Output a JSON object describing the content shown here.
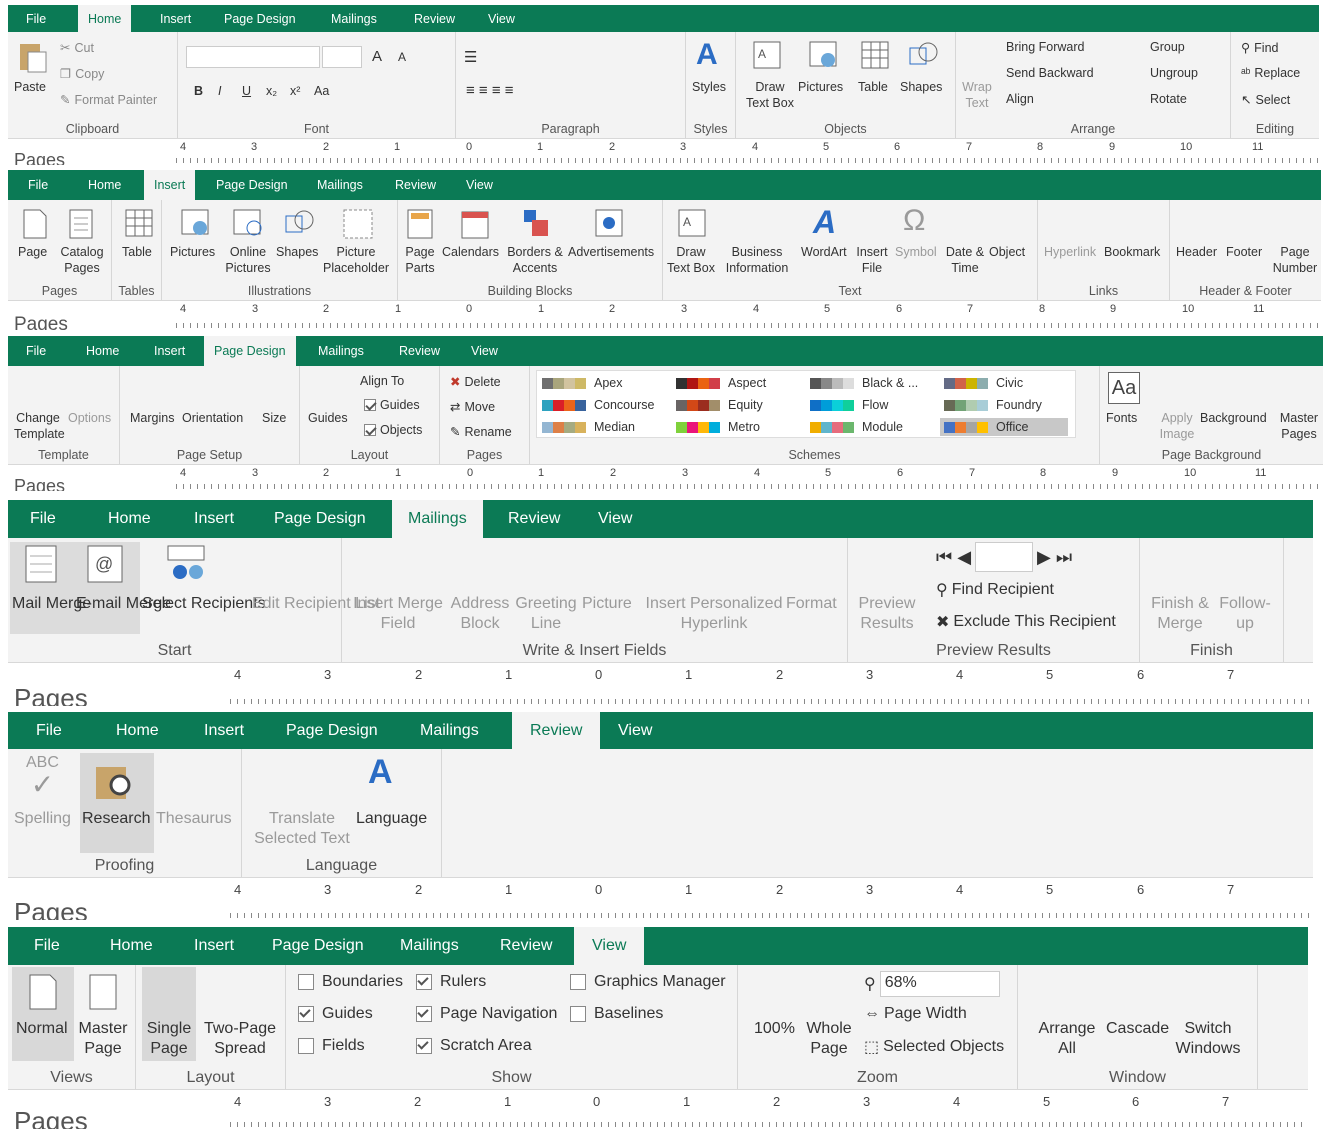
{
  "tabs": [
    "File",
    "Home",
    "Insert",
    "Page Design",
    "Mailings",
    "Review",
    "View"
  ],
  "home": {
    "clipboard": {
      "paste": "Paste",
      "cut": "Cut",
      "copy": "Copy",
      "format_painter": "Format Painter",
      "label": "Clipboard"
    },
    "font": {
      "bold": "B",
      "italic": "I",
      "underline": "U",
      "sub": "x₂",
      "sup": "x²",
      "grow": "A",
      "shrink": "A",
      "aa": "Aa",
      "label": "Font"
    },
    "paragraph": {
      "label": "Paragraph"
    },
    "styles": {
      "styles": "Styles",
      "label": "Styles"
    },
    "objects": {
      "draw_text_box": "Draw Text Box",
      "pictures": "Pictures",
      "table": "Table",
      "shapes": "Shapes",
      "label": "Objects"
    },
    "arrange": {
      "wrap_text": "Wrap Text",
      "bring_forward": "Bring Forward",
      "send_backward": "Send Backward",
      "align": "Align",
      "group": "Group",
      "ungroup": "Ungroup",
      "rotate": "Rotate",
      "label": "Arrange"
    },
    "editing": {
      "find": "Find",
      "replace": "Replace",
      "select": "Select",
      "label": "Editing"
    }
  },
  "insert": {
    "pages": {
      "page": "Page",
      "catalog_pages": "Catalog Pages",
      "label": "Pages"
    },
    "tables": {
      "table": "Table",
      "label": "Tables"
    },
    "illustrations": {
      "pictures": "Pictures",
      "online_pictures": "Online Pictures",
      "shapes": "Shapes",
      "picture_placeholder": "Picture Placeholder",
      "label": "Illustrations"
    },
    "building_blocks": {
      "page_parts": "Page Parts",
      "calendars": "Calendars",
      "borders_accents": "Borders & Accents",
      "advertisements": "Advertisements",
      "label": "Building Blocks"
    },
    "text": {
      "draw_text_box": "Draw Text Box",
      "business_information": "Business Information",
      "wordart": "WordArt",
      "insert_file": "Insert File",
      "symbol": "Symbol",
      "date_time": "Date & Time",
      "object": "Object",
      "label": "Text"
    },
    "links": {
      "hyperlink": "Hyperlink",
      "bookmark": "Bookmark",
      "label": "Links"
    },
    "header_footer": {
      "header": "Header",
      "footer": "Footer",
      "page_number": "Page Number",
      "label": "Header & Footer"
    }
  },
  "design": {
    "template": {
      "change_template": "Change Template",
      "options": "Options",
      "label": "Template"
    },
    "page_setup": {
      "margins": "Margins",
      "orientation": "Orientation",
      "size": "Size",
      "label": "Page Setup"
    },
    "layout": {
      "guides": "Guides",
      "align_to": "Align To",
      "guides_check": "Guides",
      "objects_check": "Objects",
      "label": "Layout"
    },
    "pages": {
      "delete": "Delete",
      "move": "Move",
      "rename": "Rename",
      "label": "Pages"
    },
    "schemes": {
      "items": [
        "Apex",
        "Aspect",
        "Black & ...",
        "Civic",
        "Concourse",
        "Equity",
        "Flow",
        "Foundry",
        "Median",
        "Metro",
        "Module",
        "Office"
      ],
      "label": "Schemes"
    },
    "background": {
      "fonts": "Fonts",
      "apply_image": "Apply Image",
      "background": "Background",
      "master_pages": "Master Pages",
      "label": "Page Background"
    }
  },
  "mailings": {
    "start": {
      "mail_merge": "Mail Merge",
      "email_merge": "E-mail Merge",
      "select_recipients": "Select Recipients",
      "edit_recipient_list": "Edit Recipient List",
      "label": "Start"
    },
    "write": {
      "insert_merge_field": "Insert Merge Field",
      "address_block": "Address Block",
      "greeting_line": "Greeting Line",
      "picture": "Picture",
      "insert_personalized_hyperlink": "Insert Personalized Hyperlink",
      "format": "Format",
      "label": "Write & Insert Fields"
    },
    "preview": {
      "preview_results": "Preview Results",
      "find_recipient": "Find Recipient",
      "exclude": "Exclude This Recipient",
      "label": "Preview Results"
    },
    "finish": {
      "finish_merge": "Finish & Merge",
      "follow_up": "Follow-up",
      "label": "Finish"
    }
  },
  "review": {
    "proofing": {
      "abc": "ABC",
      "spelling": "Spelling",
      "research": "Research",
      "thesaurus": "Thesaurus",
      "label": "Proofing"
    },
    "language": {
      "translate": "Translate Selected Text",
      "language": "Language",
      "label": "Language"
    }
  },
  "view": {
    "views": {
      "normal": "Normal",
      "master_page": "Master Page",
      "label": "Views"
    },
    "layout": {
      "single_page": "Single Page",
      "two_page_spread": "Two-Page Spread",
      "label": "Layout"
    },
    "show": {
      "boundaries": "Boundaries",
      "guides": "Guides",
      "fields": "Fields",
      "rulers": "Rulers",
      "page_navigation": "Page Navigation",
      "scratch_area": "Scratch Area",
      "graphics_manager": "Graphics Manager",
      "baselines": "Baselines",
      "label": "Show"
    },
    "zoom": {
      "pct100": "100%",
      "whole_page": "Whole Page",
      "zoom_value": "68%",
      "page_width": "Page Width",
      "selected_objects": "Selected Objects",
      "label": "Zoom"
    },
    "window": {
      "arrange_all": "Arrange All",
      "cascade": "Cascade",
      "switch_windows": "Switch Windows",
      "label": "Window"
    }
  },
  "pages_pane": "Pages",
  "ruler_ticks_small": [
    "4",
    "3",
    "2",
    "1",
    "0",
    "1",
    "2",
    "3",
    "4",
    "5",
    "6",
    "7",
    "8",
    "9",
    "10",
    "11"
  ],
  "ruler_ticks_large": [
    "4",
    "3",
    "2",
    "1",
    "0",
    "1",
    "2",
    "3",
    "4",
    "5",
    "6",
    "7"
  ]
}
